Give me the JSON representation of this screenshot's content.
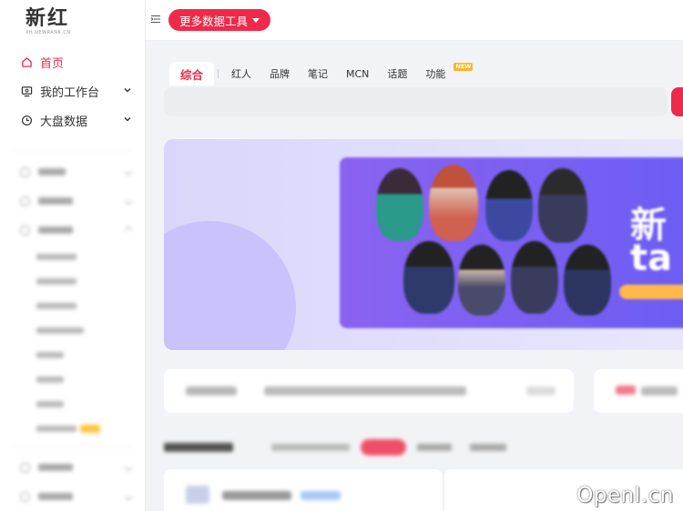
{
  "logo": {
    "main": "新红",
    "sub": "XH.NEWRANK.CN"
  },
  "sidebar": {
    "items": [
      {
        "label": "首页",
        "icon": "home-icon",
        "active": true
      },
      {
        "label": "我的工作台",
        "icon": "workbench-icon",
        "expandable": true
      },
      {
        "label": "大盘数据",
        "icon": "dashboard-icon",
        "expandable": true
      }
    ]
  },
  "topbar": {
    "more_tools": "更多数据工具"
  },
  "search": {
    "tabs": [
      {
        "label": "综合",
        "active": true
      },
      {
        "label": "红人"
      },
      {
        "label": "品牌"
      },
      {
        "label": "笔记"
      },
      {
        "label": "MCN"
      },
      {
        "label": "话题"
      },
      {
        "label": "功能",
        "badge": "NEW"
      }
    ]
  },
  "banner": {
    "text_big_1": "新",
    "text_big_2": "ta"
  },
  "watermark": "OpenI.cn",
  "colors": {
    "accent": "#ee2a4a",
    "badge": "#ffb32a",
    "banner": "#7a5ff2"
  }
}
